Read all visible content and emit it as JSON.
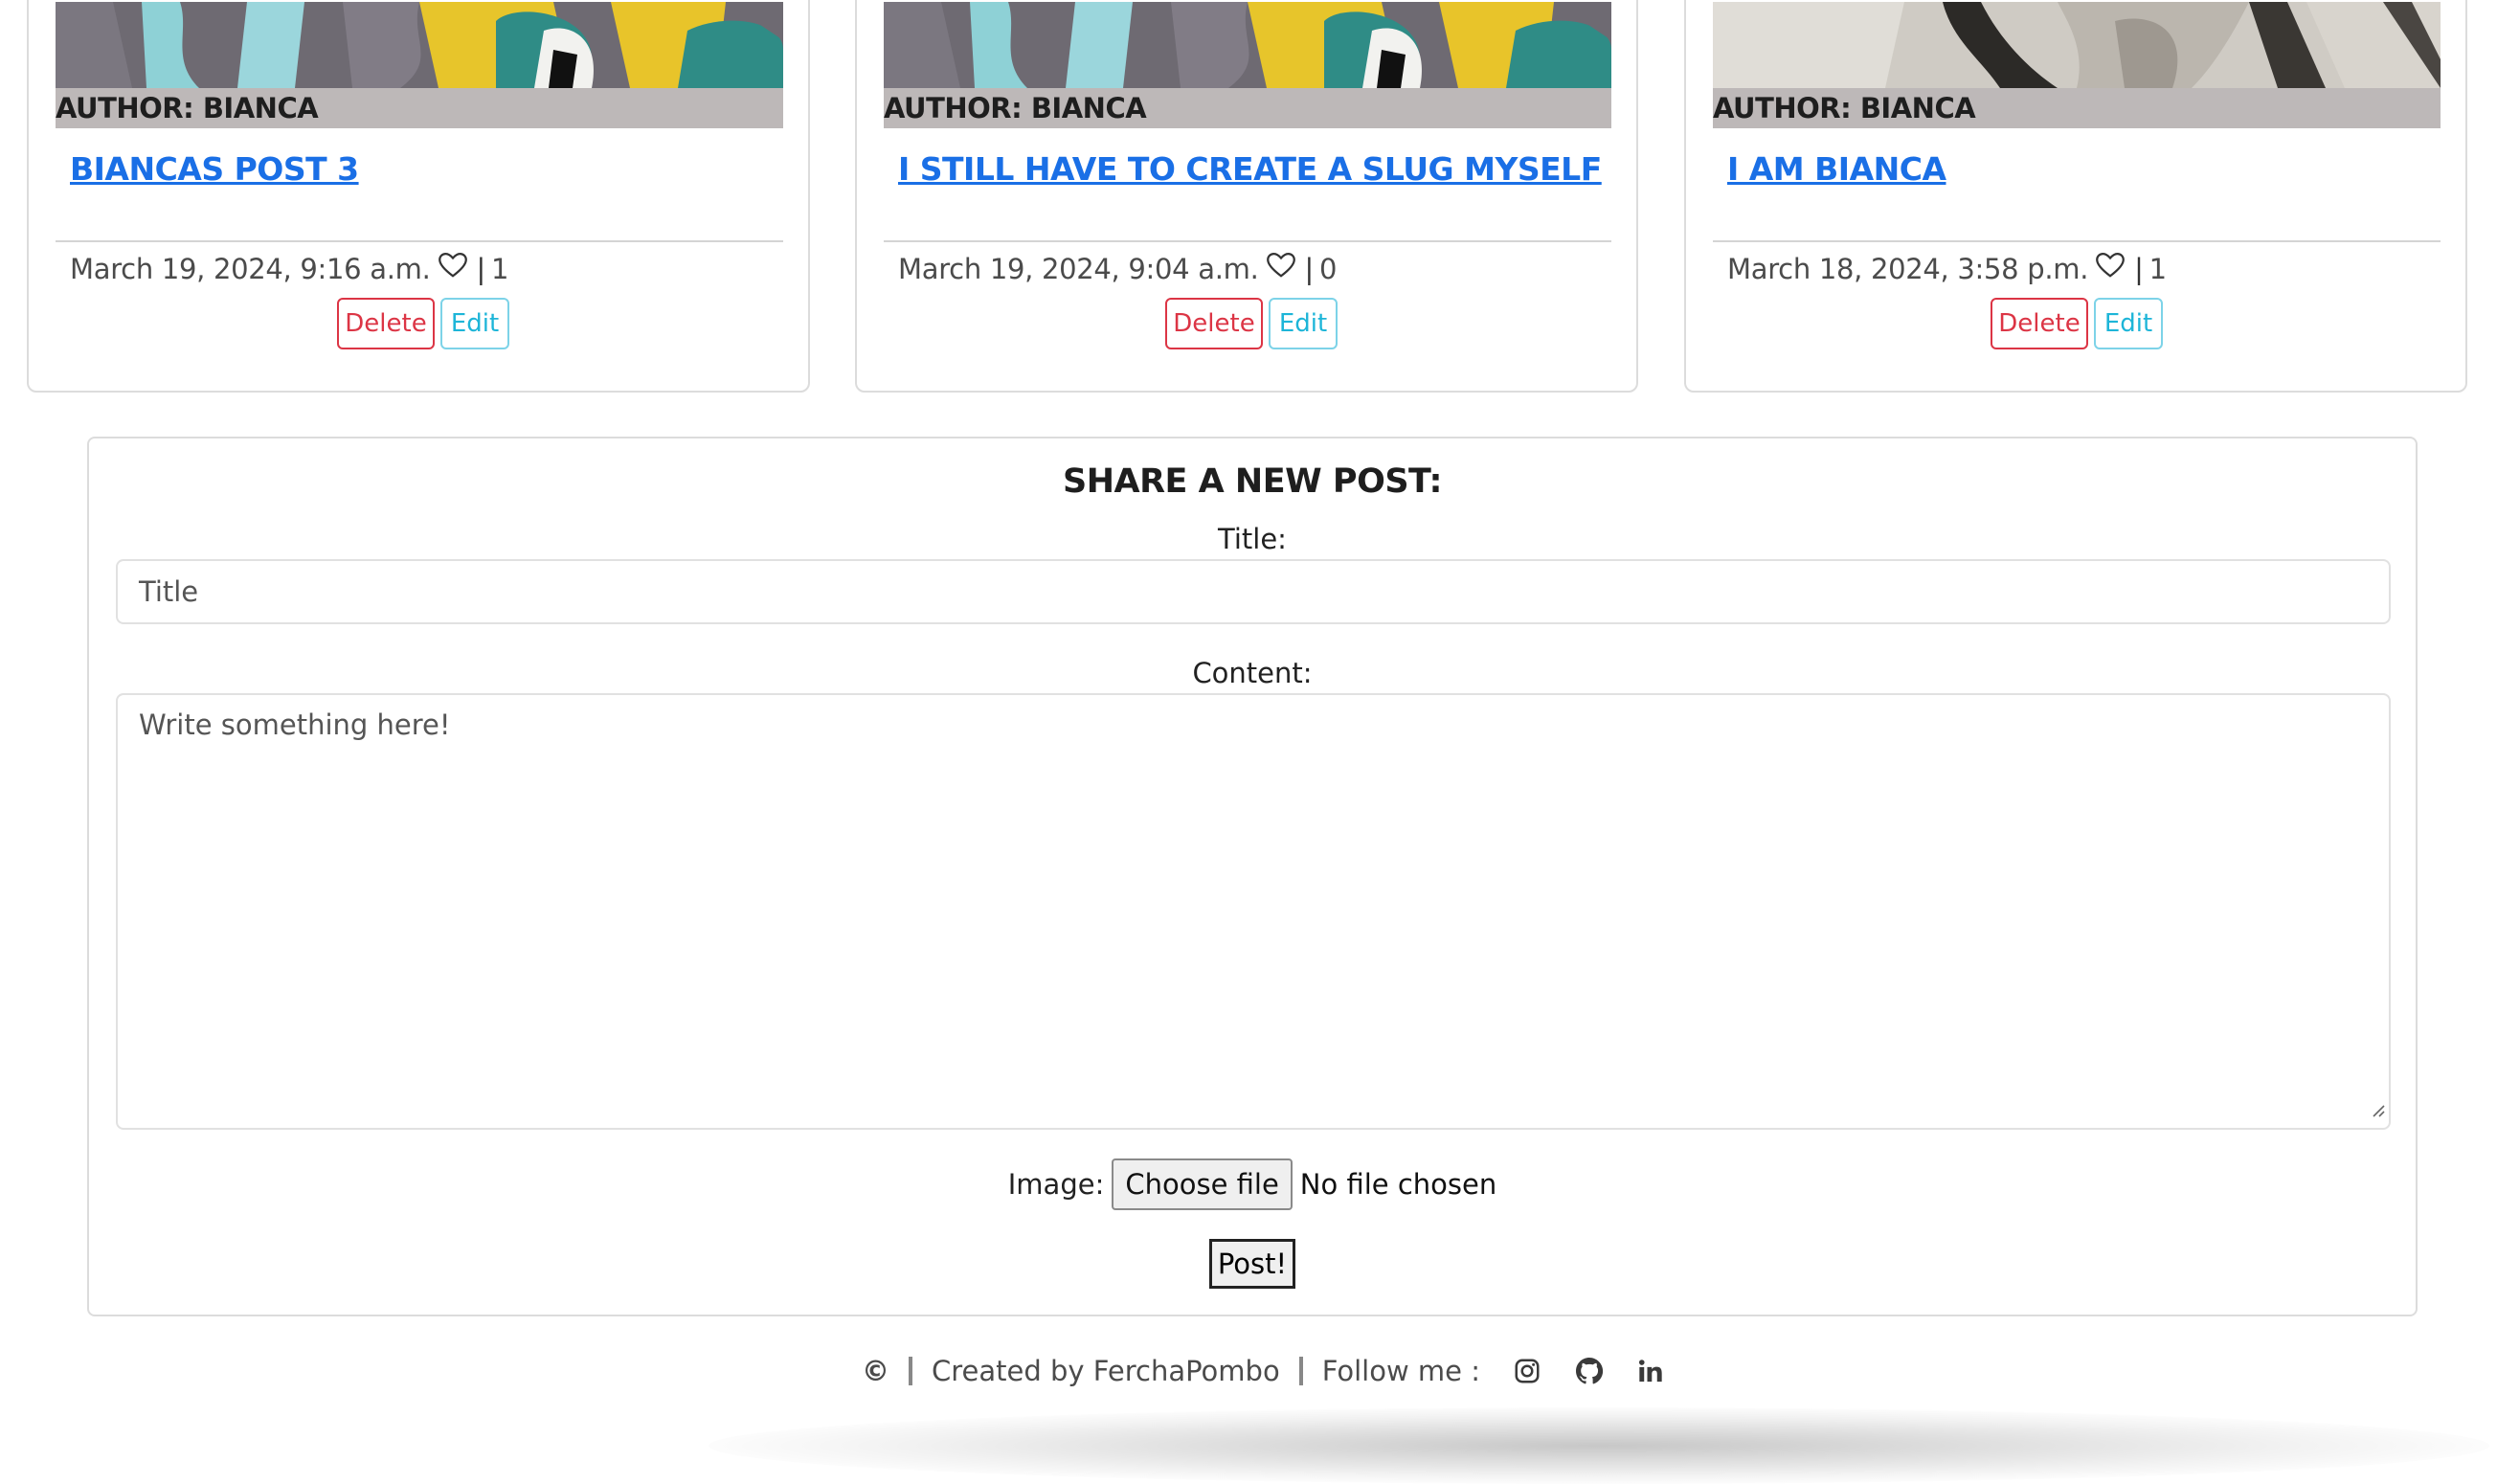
{
  "posts": [
    {
      "author": "AUTHOR: BIANCA",
      "title": "BIANCAS POST 3",
      "date": "March 19, 2024, 9:16 a.m.",
      "likes": "1",
      "delete_label": "Delete",
      "edit_label": "Edit"
    },
    {
      "author": "AUTHOR: BIANCA",
      "title": "I STILL HAVE TO CREATE A SLUG MYSELF",
      "date": "March 19, 2024, 9:04 a.m.",
      "likes": "0",
      "delete_label": "Delete",
      "edit_label": "Edit"
    },
    {
      "author": "AUTHOR: BIANCA",
      "title": "I AM BIANCA",
      "date": "March 18, 2024, 3:58 p.m.",
      "likes": "1",
      "delete_label": "Delete",
      "edit_label": "Edit"
    }
  ],
  "new_post": {
    "heading": "SHARE A NEW POST:",
    "title_label": "Title:",
    "title_placeholder": "Title",
    "content_label": "Content:",
    "content_placeholder": "Write something here!",
    "image_label": "Image:",
    "choose_file_label": "Choose file",
    "file_status": "No file chosen",
    "submit_label": "Post!"
  },
  "footer": {
    "copyright_symbol": "©",
    "created_by": "Created by FerchaPombo",
    "follow_label": "Follow me :",
    "icons": [
      "instagram-icon",
      "github-icon",
      "linkedin-icon"
    ]
  },
  "colors": {
    "link": "#1a6fe6",
    "danger": "#dc3545",
    "info": "#1db5d8",
    "author_bar": "#bdb8b8"
  }
}
